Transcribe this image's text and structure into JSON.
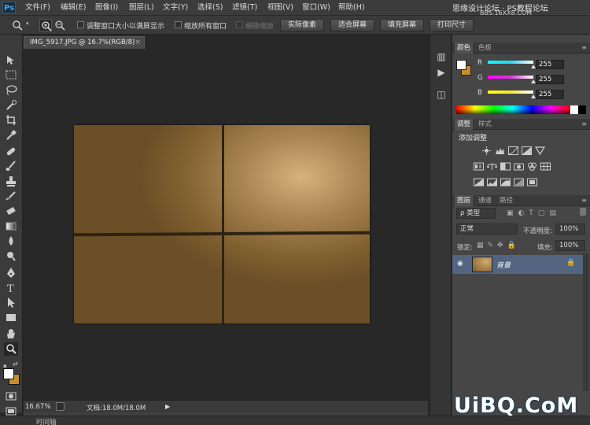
{
  "app": {
    "logo": "Ps"
  },
  "menu": [
    "文件(F)",
    "编辑(E)",
    "图像(I)",
    "图层(L)",
    "文字(Y)",
    "选择(S)",
    "滤镜(T)",
    "视图(V)",
    "窗口(W)",
    "帮助(H)"
  ],
  "watermark": {
    "top": "思缘设计论坛 · PS教程论坛",
    "url": "BBS.16XX8.COM",
    "brand": "UiBQ.CoM",
    "photo": "http://photo.poco.cn/"
  },
  "options": {
    "resize_windows": "调整窗口大小以满屏显示",
    "zoom_all_windows": "缩放所有窗口",
    "scrubby_zoom": "细微缩放",
    "actual_pixels": "实际像素",
    "fit_screen": "适合屏幕",
    "fill_screen": "填充屏幕",
    "print_size": "打印尺寸"
  },
  "document": {
    "tab_title": "IMG_5917.JPG @ 16.7%(RGB/8)",
    "close": "×"
  },
  "status": {
    "zoom": "16.67%",
    "doc_size": "文档:18.0M/18.0M",
    "arrow": "▶"
  },
  "timeline": {
    "label": "时间轴"
  },
  "color_panel": {
    "tabs": [
      "颜色",
      "色板"
    ],
    "channels": [
      {
        "label": "R",
        "value": "255",
        "color": "#25d6f2"
      },
      {
        "label": "G",
        "value": "255",
        "color": "#d23ad6"
      },
      {
        "label": "B",
        "value": "255",
        "color": "#f3e832"
      }
    ],
    "foreground": "#ffffff",
    "background": "#c88d2e"
  },
  "adjust_panel": {
    "tabs": [
      "调整",
      "样式"
    ],
    "title": "添加调整"
  },
  "layers_panel": {
    "tabs": [
      "图层",
      "通道",
      "路径"
    ],
    "filter_kind": "ρ 类型",
    "blend_mode": "正常",
    "opacity_label": "不透明度:",
    "opacity_value": "100%",
    "lock_label": "锁定:",
    "fill_label": "填充:",
    "fill_value": "100%",
    "layer_name": "背景"
  },
  "photo": {
    "highlight_color": "#d7b27a",
    "base_color": "#80602f"
  }
}
